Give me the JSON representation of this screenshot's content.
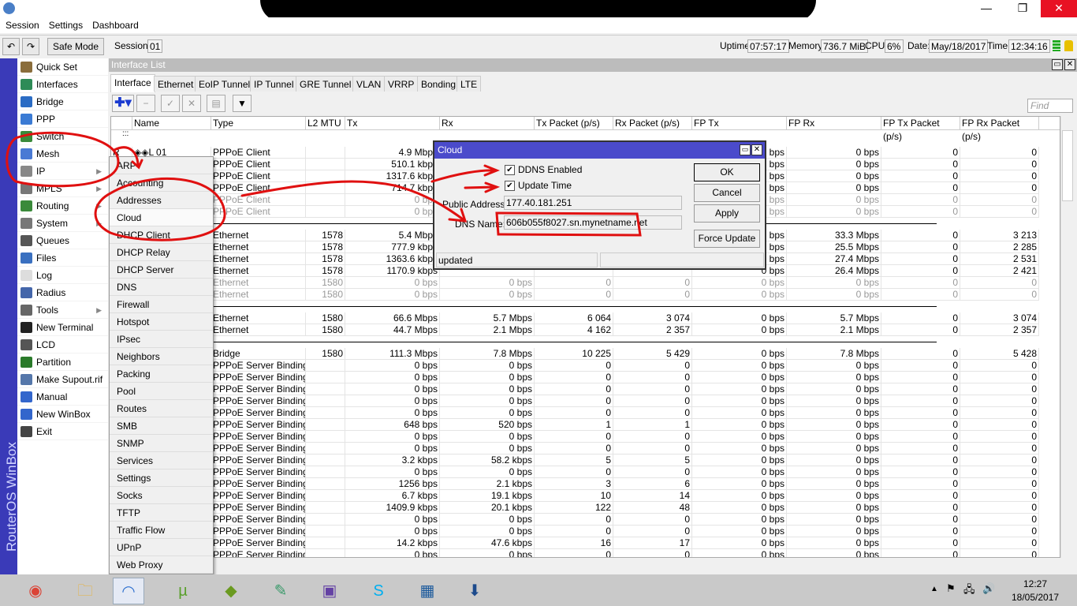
{
  "window": {
    "title": "",
    "min": "—",
    "max": "❐",
    "close": "✕"
  },
  "menubar": [
    "Session",
    "Settings",
    "Dashboard"
  ],
  "toolbar": {
    "undo": "↶",
    "redo": "↷",
    "safe_mode": "Safe Mode",
    "session_label": "Session:",
    "session_value": "01",
    "uptime_label": "Uptime:",
    "uptime": "07:57:17",
    "memory_label": "Memory:",
    "memory": "736.7 MiB",
    "cpu_label": "CPU:",
    "cpu": "6%",
    "date_label": "Date:",
    "date": "May/18/2017",
    "time_label": "Time:",
    "time": "12:34:16"
  },
  "brand": "RouterOS WinBox",
  "sidebar": [
    {
      "label": "Quick Set",
      "color": "#8a6d3b"
    },
    {
      "label": "Interfaces",
      "color": "#2e8b57"
    },
    {
      "label": "Bridge",
      "color": "#2b6cc4"
    },
    {
      "label": "PPP",
      "color": "#3b7bd4"
    },
    {
      "label": "Switch",
      "color": "#3a8a3a"
    },
    {
      "label": "Mesh",
      "color": "#4a7ad4"
    },
    {
      "label": "IP",
      "color": "#888888",
      "sub": true
    },
    {
      "label": "MPLS",
      "color": "#777777",
      "sub": true
    },
    {
      "label": "Routing",
      "color": "#3a8a3a",
      "sub": true
    },
    {
      "label": "System",
      "color": "#777777",
      "sub": true
    },
    {
      "label": "Queues",
      "color": "#555555"
    },
    {
      "label": "Files",
      "color": "#3a70c0"
    },
    {
      "label": "Log",
      "color": "#dddddd"
    },
    {
      "label": "Radius",
      "color": "#4466aa"
    },
    {
      "label": "Tools",
      "color": "#666666",
      "sub": true
    },
    {
      "label": "New Terminal",
      "color": "#222222"
    },
    {
      "label": "LCD",
      "color": "#555555"
    },
    {
      "label": "Partition",
      "color": "#2a7a2a"
    },
    {
      "label": "Make Supout.rif",
      "color": "#5577aa"
    },
    {
      "label": "Manual",
      "color": "#3366cc"
    },
    {
      "label": "New WinBox",
      "color": "#3366cc"
    },
    {
      "label": "Exit",
      "color": "#444444"
    }
  ],
  "ip_menu": [
    "ARP",
    "Accounting",
    "Addresses",
    "Cloud",
    "DHCP Client",
    "DHCP Relay",
    "DHCP Server",
    "DNS",
    "Firewall",
    "Hotspot",
    "IPsec",
    "Neighbors",
    "Packing",
    "Pool",
    "Routes",
    "SMB",
    "SNMP",
    "Services",
    "Settings",
    "Socks",
    "TFTP",
    "Traffic Flow",
    "UPnP",
    "Web Proxy"
  ],
  "interface_list": {
    "title": "Interface List",
    "tabs": [
      "Interface",
      "Ethernet",
      "EoIP Tunnel",
      "IP Tunnel",
      "GRE Tunnel",
      "VLAN",
      "VRRP",
      "Bonding",
      "LTE"
    ],
    "find_placeholder": "Find",
    "columns": [
      "",
      "Name",
      "Type",
      "L2 MTU",
      "Tx",
      "Rx",
      "Tx Packet (p/s)",
      "Rx Packet (p/s)",
      "FP Tx",
      "FP Rx",
      "FP Tx Packet (p/s)",
      "FP Rx Packet (p/s)"
    ],
    "group_marker": ":::",
    "rows": [
      {
        "flag": "R",
        "name": "◈◈L 01",
        "type": "PPPoE Client",
        "mtu": "",
        "tx": "4.9 Mbps",
        "rx": "",
        "txp": "",
        "rxp": "",
        "fptx": "0 bps",
        "fprx": "0 bps",
        "fptxp": "0",
        "fprxp": "0"
      },
      {
        "name": "",
        "type": "PPPoE Client",
        "mtu": "",
        "tx": "510.1 kbps",
        "rx": "",
        "txp": "",
        "rxp": "",
        "fptx": "0 bps",
        "fprx": "0 bps",
        "fptxp": "0",
        "fprxp": "0"
      },
      {
        "name": "",
        "type": "PPPoE Client",
        "mtu": "",
        "tx": "1317.6 kbps",
        "rx": "",
        "txp": "",
        "rxp": "",
        "fptx": "0 bps",
        "fprx": "0 bps",
        "fptxp": "0",
        "fprxp": "0"
      },
      {
        "name": "",
        "type": "PPPoE Client",
        "mtu": "",
        "tx": "714.7 kbps",
        "rx": "",
        "txp": "",
        "rxp": "",
        "fptx": "0 bps",
        "fprx": "0 bps",
        "fptxp": "0",
        "fprxp": "0"
      },
      {
        "name": "",
        "type": "PPPoE Client",
        "mtu": "",
        "tx": "0 bps",
        "rx": "",
        "txp": "",
        "rxp": "",
        "fptx": "0 bps",
        "fprx": "0 bps",
        "fptxp": "0",
        "fprxp": "0",
        "disabled": true
      },
      {
        "name": "",
        "type": "PPPoE Client",
        "mtu": "",
        "tx": "0 bps",
        "rx": "",
        "txp": "",
        "rxp": "",
        "fptx": "0 bps",
        "fprx": "0 bps",
        "fptxp": "0",
        "fprxp": "0",
        "disabled": true
      },
      {
        "sep": true
      },
      {
        "name": "",
        "type": "Ethernet",
        "mtu": "1578",
        "tx": "5.4 Mbps",
        "rx": "",
        "txp": "",
        "rxp": "",
        "fptx": "0 bps",
        "fprx": "33.3 Mbps",
        "fptxp": "0",
        "fprxp": "3 213"
      },
      {
        "name": "",
        "type": "Ethernet",
        "mtu": "1578",
        "tx": "777.9 kbps",
        "rx": "",
        "txp": "",
        "rxp": "",
        "fptx": "0 bps",
        "fprx": "25.5 Mbps",
        "fptxp": "0",
        "fprxp": "2 285"
      },
      {
        "name": "",
        "type": "Ethernet",
        "mtu": "1578",
        "tx": "1363.6 kbps",
        "rx": "",
        "txp": "",
        "rxp": "",
        "fptx": "0 bps",
        "fprx": "27.4 Mbps",
        "fptxp": "0",
        "fprxp": "2 531"
      },
      {
        "name": "",
        "type": "Ethernet",
        "mtu": "1578",
        "tx": "1170.9 kbps",
        "rx": "",
        "txp": "",
        "rxp": "",
        "fptx": "0 bps",
        "fprx": "26.4 Mbps",
        "fptxp": "0",
        "fprxp": "2 421"
      },
      {
        "name": "",
        "type": "Ethernet",
        "mtu": "1580",
        "tx": "0 bps",
        "rx": "0 bps",
        "txp": "0",
        "rxp": "0",
        "fptx": "0 bps",
        "fprx": "0 bps",
        "fptxp": "0",
        "fprxp": "0",
        "disabled": true
      },
      {
        "name": "",
        "type": "Ethernet",
        "mtu": "1580",
        "tx": "0 bps",
        "rx": "0 bps",
        "txp": "0",
        "rxp": "0",
        "fptx": "0 bps",
        "fprx": "0 bps",
        "fptxp": "0",
        "fprxp": "0",
        "disabled": true
      },
      {
        "sep": true
      },
      {
        "name": "",
        "type": "Ethernet",
        "mtu": "1580",
        "tx": "66.6 Mbps",
        "rx": "5.7 Mbps",
        "txp": "6 064",
        "rxp": "3 074",
        "fptx": "0 bps",
        "fprx": "5.7 Mbps",
        "fptxp": "0",
        "fprxp": "3 074"
      },
      {
        "name": "",
        "type": "Ethernet",
        "mtu": "1580",
        "tx": "44.7 Mbps",
        "rx": "2.1 Mbps",
        "txp": "4 162",
        "rxp": "2 357",
        "fptx": "0 bps",
        "fprx": "2.1 Mbps",
        "fptxp": "0",
        "fprxp": "2 357"
      },
      {
        "sep": true
      },
      {
        "name": "",
        "type": "Bridge",
        "mtu": "1580",
        "tx": "111.3 Mbps",
        "rx": "7.8 Mbps",
        "txp": "10 225",
        "rxp": "5 429",
        "fptx": "0 bps",
        "fprx": "7.8 Mbps",
        "fptxp": "0",
        "fprxp": "5 428"
      },
      {
        "name": "",
        "type": "PPPoE Server Binding",
        "mtu": "",
        "tx": "0 bps",
        "rx": "0 bps",
        "txp": "0",
        "rxp": "0",
        "fptx": "0 bps",
        "fprx": "0 bps",
        "fptxp": "0",
        "fprxp": "0"
      },
      {
        "name": "",
        "type": "PPPoE Server Binding",
        "mtu": "",
        "tx": "0 bps",
        "rx": "0 bps",
        "txp": "0",
        "rxp": "0",
        "fptx": "0 bps",
        "fprx": "0 bps",
        "fptxp": "0",
        "fprxp": "0"
      },
      {
        "name": "",
        "type": "PPPoE Server Binding",
        "mtu": "",
        "tx": "0 bps",
        "rx": "0 bps",
        "txp": "0",
        "rxp": "0",
        "fptx": "0 bps",
        "fprx": "0 bps",
        "fptxp": "0",
        "fprxp": "0"
      },
      {
        "name": "",
        "type": "PPPoE Server Binding",
        "mtu": "",
        "tx": "0 bps",
        "rx": "0 bps",
        "txp": "0",
        "rxp": "0",
        "fptx": "0 bps",
        "fprx": "0 bps",
        "fptxp": "0",
        "fprxp": "0"
      },
      {
        "name": "",
        "type": "PPPoE Server Binding",
        "mtu": "",
        "tx": "0 bps",
        "rx": "0 bps",
        "txp": "0",
        "rxp": "0",
        "fptx": "0 bps",
        "fprx": "0 bps",
        "fptxp": "0",
        "fprxp": "0"
      },
      {
        "name": "",
        "type": "PPPoE Server Binding",
        "mtu": "",
        "tx": "648 bps",
        "rx": "520 bps",
        "txp": "1",
        "rxp": "1",
        "fptx": "0 bps",
        "fprx": "0 bps",
        "fptxp": "0",
        "fprxp": "0"
      },
      {
        "name": "",
        "type": "PPPoE Server Binding",
        "mtu": "",
        "tx": "0 bps",
        "rx": "0 bps",
        "txp": "0",
        "rxp": "0",
        "fptx": "0 bps",
        "fprx": "0 bps",
        "fptxp": "0",
        "fprxp": "0"
      },
      {
        "name": "",
        "type": "PPPoE Server Binding",
        "mtu": "",
        "tx": "0 bps",
        "rx": "0 bps",
        "txp": "0",
        "rxp": "0",
        "fptx": "0 bps",
        "fprx": "0 bps",
        "fptxp": "0",
        "fprxp": "0"
      },
      {
        "name": "",
        "type": "PPPoE Server Binding",
        "mtu": "",
        "tx": "3.2 kbps",
        "rx": "58.2 kbps",
        "txp": "5",
        "rxp": "5",
        "fptx": "0 bps",
        "fprx": "0 bps",
        "fptxp": "0",
        "fprxp": "0"
      },
      {
        "name": "",
        "type": "PPPoE Server Binding",
        "mtu": "",
        "tx": "0 bps",
        "rx": "0 bps",
        "txp": "0",
        "rxp": "0",
        "fptx": "0 bps",
        "fprx": "0 bps",
        "fptxp": "0",
        "fprxp": "0"
      },
      {
        "name": "",
        "type": "PPPoE Server Binding",
        "mtu": "",
        "tx": "1256 bps",
        "rx": "2.1 kbps",
        "txp": "3",
        "rxp": "6",
        "fptx": "0 bps",
        "fprx": "0 bps",
        "fptxp": "0",
        "fprxp": "0"
      },
      {
        "name": "",
        "type": "PPPoE Server Binding",
        "mtu": "",
        "tx": "6.7 kbps",
        "rx": "19.1 kbps",
        "txp": "10",
        "rxp": "14",
        "fptx": "0 bps",
        "fprx": "0 bps",
        "fptxp": "0",
        "fprxp": "0"
      },
      {
        "name": "",
        "type": "PPPoE Server Binding",
        "mtu": "",
        "tx": "1409.9 kbps",
        "rx": "20.1 kbps",
        "txp": "122",
        "rxp": "48",
        "fptx": "0 bps",
        "fprx": "0 bps",
        "fptxp": "0",
        "fprxp": "0"
      },
      {
        "name": "",
        "type": "PPPoE Server Binding",
        "mtu": "",
        "tx": "0 bps",
        "rx": "0 bps",
        "txp": "0",
        "rxp": "0",
        "fptx": "0 bps",
        "fprx": "0 bps",
        "fptxp": "0",
        "fprxp": "0"
      },
      {
        "name": "",
        "type": "PPPoE Server Binding",
        "mtu": "",
        "tx": "0 bps",
        "rx": "0 bps",
        "txp": "0",
        "rxp": "0",
        "fptx": "0 bps",
        "fprx": "0 bps",
        "fptxp": "0",
        "fprxp": "0"
      },
      {
        "name": "",
        "type": "PPPoE Server Binding",
        "mtu": "",
        "tx": "14.2 kbps",
        "rx": "47.6 kbps",
        "txp": "16",
        "rxp": "17",
        "fptx": "0 bps",
        "fprx": "0 bps",
        "fptxp": "0",
        "fprxp": "0"
      },
      {
        "name": "",
        "type": "PPPoE Server Binding",
        "mtu": "",
        "tx": "0 bps",
        "rx": "0 bps",
        "txp": "0",
        "rxp": "0",
        "fptx": "0 bps",
        "fprx": "0 bps",
        "fptxp": "0",
        "fprxp": "0"
      }
    ]
  },
  "cloud_dialog": {
    "title": "Cloud",
    "ddns_enabled": "DDNS Enabled",
    "update_time": "Update Time",
    "public_address_label": "Public Address:",
    "public_address": "177.40.181.251",
    "dns_name_label": "DNS Name:",
    "dns_name": "606b055f8027.sn.mynetname.net",
    "ok": "OK",
    "cancel": "Cancel",
    "apply": "Apply",
    "force_update": "Force Update",
    "status": "updated",
    "check": "✔"
  },
  "taskbar": {
    "time": "12:27",
    "date": "18/05/2017",
    "apps": [
      "chrome-icon",
      "file-explorer-icon",
      "winbox-icon",
      "utorrent-icon",
      "app-icon",
      "app2-icon",
      "twitch-icon",
      "skype-icon",
      "virtualbox-icon",
      "download-icon"
    ]
  },
  "accent": "#4b4bcb",
  "annotation_color": "#e01010"
}
